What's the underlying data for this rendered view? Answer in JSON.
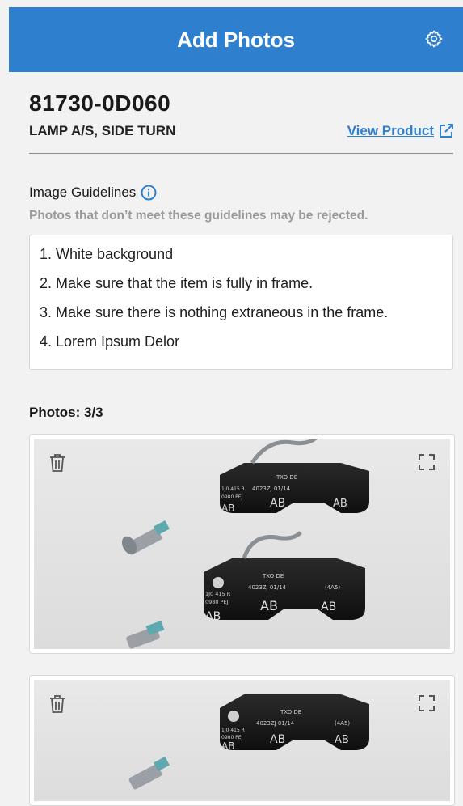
{
  "header": {
    "title": "Add Photos"
  },
  "product": {
    "part_number": "81730-0D060",
    "description": "LAMP A/S, SIDE TURN",
    "view_link": "View Product"
  },
  "guidelines": {
    "title": "Image Guidelines",
    "note": "Photos that don’t meet these guidelines may be rejected.",
    "items": [
      "1. White background",
      "2. Make sure that the item is fully in frame.",
      "3. Make sure there is nothing extraneous in the frame.",
      "4. Lorem Ipsum Delor"
    ]
  },
  "photos": {
    "label": "Photos: 3/3",
    "pad_texts": {
      "model": "TXO DE",
      "code": "4023ZJ 01/14",
      "part": "1J0 415 R",
      "batch": "0980 PEJ",
      "grade": "AB",
      "spec": "(4A5)"
    }
  },
  "colors": {
    "accent": "#2f7fcf",
    "background": "#f2f2f2"
  }
}
